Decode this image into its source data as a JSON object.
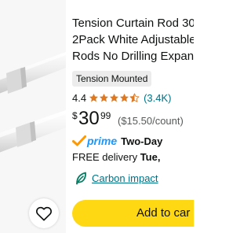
{
  "product": {
    "title_lines": [
      "Tension Curtain Rod 30",
      "2Pack White Adjustable",
      "Rods No Drilling Expan"
    ],
    "badge": "Tension Mounted",
    "rating": {
      "value": "4.4",
      "stars": 4.5,
      "count": "(3.4K)"
    },
    "price": {
      "symbol": "$",
      "whole": "30",
      "fraction": "99",
      "unit_price": "($15.50/count)"
    },
    "prime": {
      "label": "prime",
      "speed": "Two-Day"
    },
    "delivery": {
      "prefix": "FREE delivery ",
      "date": "Tue,"
    },
    "carbon": {
      "label": "Carbon impact"
    },
    "actions": {
      "add_to_cart": "Add to car"
    }
  },
  "icons": {
    "wishlist": "heart-outline-icon",
    "star": "star-icon",
    "prime": "prime-check-icon",
    "carbon": "leaf-icon"
  },
  "colors": {
    "star": "#de7921",
    "link": "#007185",
    "prime": "#1a98ff",
    "button": "#ffd814",
    "badge_bg": "#ececec"
  }
}
